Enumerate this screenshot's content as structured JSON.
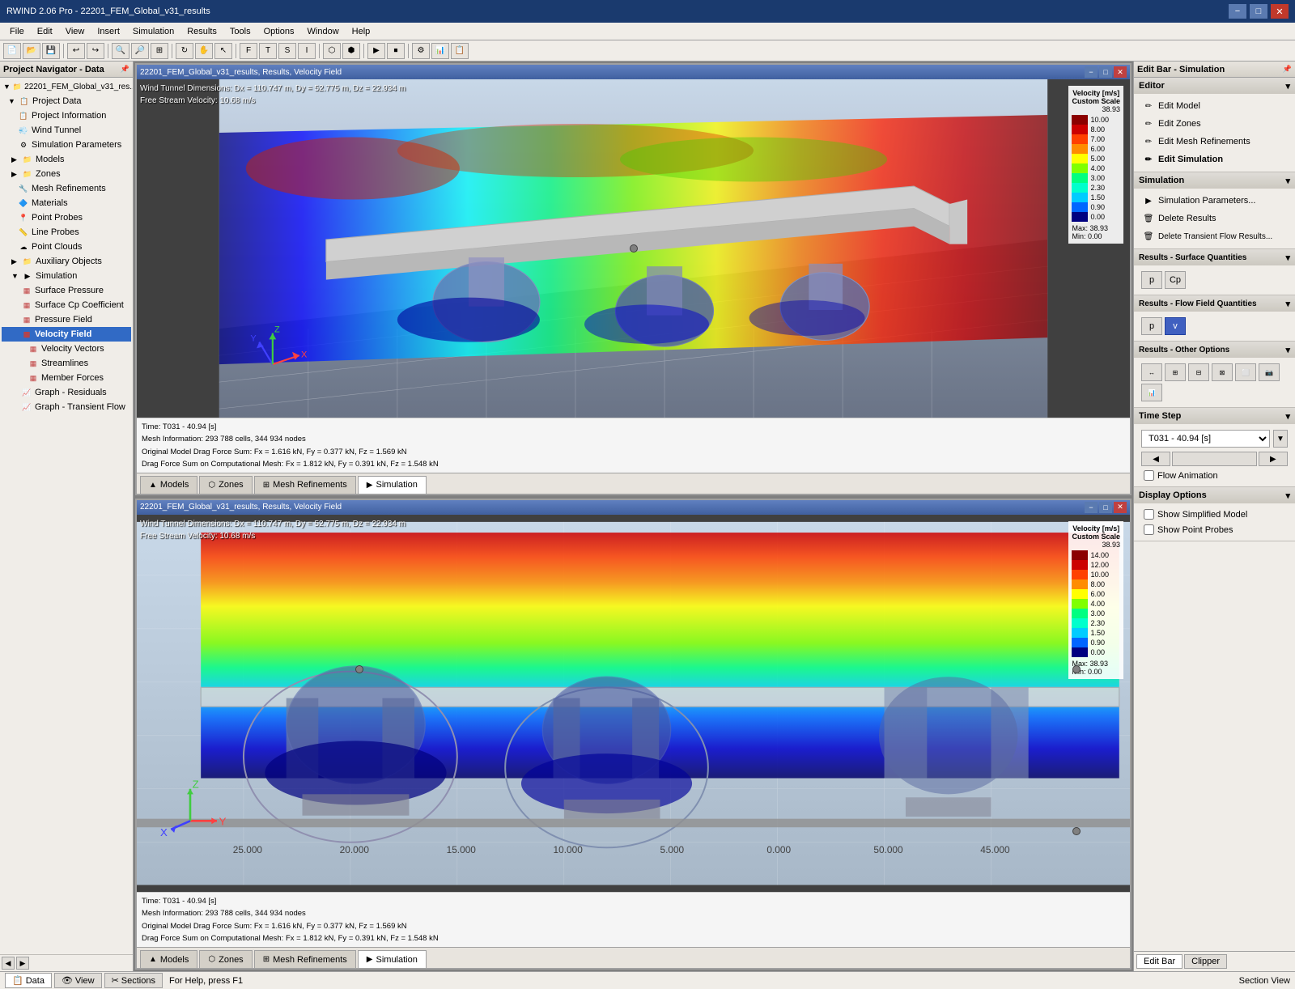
{
  "app": {
    "title": "RWIND 2.06 Pro - 22201_FEM_Global_v31_results",
    "min_label": "−",
    "max_label": "□",
    "close_label": "✕"
  },
  "menu": {
    "items": [
      "File",
      "Edit",
      "View",
      "Insert",
      "Simulation",
      "Results",
      "Tools",
      "Options",
      "Window",
      "Help"
    ]
  },
  "left_panel": {
    "title": "Project Navigator - Data",
    "project_root": "22201_FEM_Global_v31_res...",
    "tree": [
      {
        "label": "Project Information",
        "indent": 1,
        "icon": "📋",
        "type": "leaf"
      },
      {
        "label": "Wind Tunnel",
        "indent": 1,
        "icon": "💨",
        "type": "leaf"
      },
      {
        "label": "Simulation Parameters",
        "indent": 1,
        "icon": "⚙",
        "type": "leaf"
      },
      {
        "label": "Models",
        "indent": 0,
        "icon": "📁",
        "type": "folder"
      },
      {
        "label": "Zones",
        "indent": 0,
        "icon": "📁",
        "type": "folder"
      },
      {
        "label": "Mesh Refinements",
        "indent": 1,
        "icon": "🔧",
        "type": "leaf"
      },
      {
        "label": "Materials",
        "indent": 1,
        "icon": "🔷",
        "type": "leaf"
      },
      {
        "label": "Point Probes",
        "indent": 1,
        "icon": "📍",
        "type": "leaf"
      },
      {
        "label": "Line Probes",
        "indent": 1,
        "icon": "📏",
        "type": "leaf"
      },
      {
        "label": "Point Clouds",
        "indent": 1,
        "icon": "☁",
        "type": "leaf"
      },
      {
        "label": "Auxiliary Objects",
        "indent": 0,
        "icon": "📁",
        "type": "folder"
      },
      {
        "label": "Simulation",
        "indent": 0,
        "icon": "▶",
        "type": "folder"
      },
      {
        "label": "Surface Pressure",
        "indent": 1,
        "icon": "▦",
        "type": "result"
      },
      {
        "label": "Surface Cp Coefficient",
        "indent": 1,
        "icon": "▦",
        "type": "result"
      },
      {
        "label": "Pressure Field",
        "indent": 1,
        "icon": "▦",
        "type": "result"
      },
      {
        "label": "Velocity Field",
        "indent": 1,
        "icon": "▦",
        "type": "result",
        "active": true
      },
      {
        "label": "Velocity Vectors",
        "indent": 1,
        "icon": "▦",
        "type": "result"
      },
      {
        "label": "Streamlines",
        "indent": 1,
        "icon": "▦",
        "type": "result"
      },
      {
        "label": "Member Forces",
        "indent": 1,
        "icon": "▦",
        "type": "result"
      },
      {
        "label": "Graph - Residuals",
        "indent": 1,
        "icon": "📈",
        "type": "graph"
      },
      {
        "label": "Graph - Transient Flow",
        "indent": 1,
        "icon": "📈",
        "type": "graph"
      }
    ]
  },
  "viewport_top": {
    "title": "22201_FEM_Global_v31_results, Results, Velocity Field",
    "info_line1": "Wind Tunnel Dimensions: Dx = 110.747 m, Dy = 52.775 m, Dz = 22.934 m",
    "info_line2": "Free Stream Velocity: 10.68 m/s",
    "time_label": "Time: T031 - 40.94 [s]",
    "mesh_info": "Mesh Information: 293 788 cells, 344 934 nodes",
    "drag_line1": "Original Model Drag Force Sum: Fx = 1.616 kN, Fy = 0.377 kN, Fz = 1.569 kN",
    "drag_line2": "Drag Force Sum on Computational Mesh: Fx = 1.812 kN, Fy = 0.391 kN, Fz = 1.548 kN",
    "scale_title": "Velocity [m/s]",
    "scale_subtitle": "Custom Scale",
    "scale_max": "38.93",
    "scale_min_label": "Min:",
    "scale_min_val": "0.00",
    "scale_max_label": "Max:",
    "scale_max_val": "38.93",
    "scale_values": [
      "10.00",
      "8.00",
      "7.00",
      "6.00",
      "5.00",
      "4.00",
      "3.00",
      "2.30",
      "1.50",
      "0.90",
      "0.00"
    ],
    "tabs": [
      "Models",
      "Zones",
      "Mesh Refinements",
      "Simulation"
    ]
  },
  "viewport_bottom": {
    "title": "22201_FEM_Global_v31_results, Results, Velocity Field",
    "info_line1": "Wind Tunnel Dimensions: Dx = 110.747 m, Dy = 52.775 m, Dz = 22.934 m",
    "info_line2": "Free Stream Velocity: 10.68 m/s",
    "time_label": "Time: T031 - 40.94 [s]",
    "mesh_info": "Mesh Information: 293 788 cells, 344 934 nodes",
    "drag_line1": "Original Model Drag Force Sum: Fx = 1.616 kN, Fy = 0.377 kN, Fz = 1.569 kN",
    "drag_line2": "Drag Force Sum on Computational Mesh: Fx = 1.812 kN, Fy = 0.391 kN, Fz = 1.548 kN",
    "scale_title": "Velocity [m/s]",
    "scale_subtitle": "Custom Scale",
    "scale_max": "38.93",
    "scale_values": [
      "14.00",
      "12.00",
      "10.00",
      "8.00",
      "6.00",
      "4.00",
      "3.00",
      "2.30",
      "1.50",
      "0.90",
      "0.00"
    ],
    "scale_min_val": "0.00",
    "scale_max_val": "38.93",
    "grid_labels": [
      "25.000",
      "20.000",
      "15.000",
      "10.000",
      "5.000",
      "0.000",
      "50.000",
      "45.000"
    ],
    "tabs": [
      "Models",
      "Zones",
      "Mesh Refinements",
      "Simulation"
    ]
  },
  "right_panel": {
    "title": "Edit Bar - Simulation",
    "editor_section": "Editor",
    "editor_buttons": [
      {
        "label": "Edit Model",
        "icon": "✏"
      },
      {
        "label": "Edit Zones",
        "icon": "✏"
      },
      {
        "label": "Edit Mesh Refinements",
        "icon": "✏"
      },
      {
        "label": "Edit Simulation",
        "icon": "✏"
      }
    ],
    "simulation_section": "Simulation",
    "simulation_buttons": [
      {
        "label": "Simulation Parameters...",
        "icon": "▶"
      },
      {
        "label": "Delete Results",
        "icon": "🗑"
      },
      {
        "label": "Delete Transient Flow Results...",
        "icon": "🗑"
      }
    ],
    "surface_section": "Results - Surface Quantities",
    "surface_buttons": [
      "p",
      "Cp"
    ],
    "flow_section": "Results - Flow Field Quantities",
    "flow_buttons": [
      "p",
      "v"
    ],
    "flow_active": "v",
    "other_section": "Results - Other Options",
    "other_buttons": [
      "≡",
      "≡",
      "≡",
      "≡",
      "≡",
      "≡",
      "≡"
    ],
    "timestep_section": "Time Step",
    "timestep_value": "T031 - 40.94 [s]",
    "flow_animation_label": "Flow Animation",
    "display_section": "Display Options",
    "display_checkboxes": [
      {
        "label": "Show Simplified Model",
        "checked": false
      },
      {
        "label": "Show Point Probes",
        "checked": false
      }
    ],
    "bottom_tabs": [
      "Edit Bar",
      "Clipper"
    ]
  },
  "status_bar": {
    "message": "For Help, press F1",
    "tabs": [
      "Data",
      "View",
      "Sections"
    ],
    "right_text": "Section View"
  }
}
